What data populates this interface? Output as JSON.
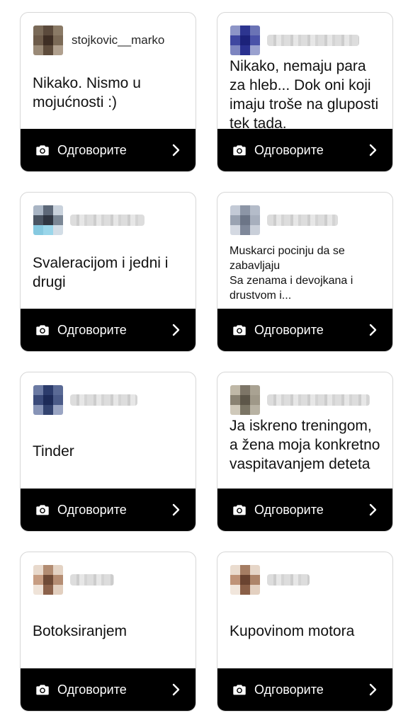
{
  "reply_label": "Одговорите",
  "icons": {
    "camera": "camera-icon",
    "chevron": "chevron-right-icon"
  },
  "cards": [
    {
      "username": "stojkovic__marko",
      "question": "Nikako. Nismo u mojućnosti :)"
    },
    {
      "username": "",
      "question": "Nikako, nemaju para za hleb... Dok oni koji imaju troše na gluposti tek tada."
    },
    {
      "username": "",
      "question": "Svaleracijom i jedni i drugi"
    },
    {
      "username": "",
      "question": "Muskarci pocinju da se zabavljaju\nSa zenama i devojkana i drustvom i..."
    },
    {
      "username": "",
      "question": "Tinder"
    },
    {
      "username": "",
      "question": "Ja iskreno treningom, a žena moja konkretno vaspitavanjem deteta"
    },
    {
      "username": "",
      "question": "Botoksiranjem"
    },
    {
      "username": "",
      "question": "Kupovinom motora"
    }
  ]
}
